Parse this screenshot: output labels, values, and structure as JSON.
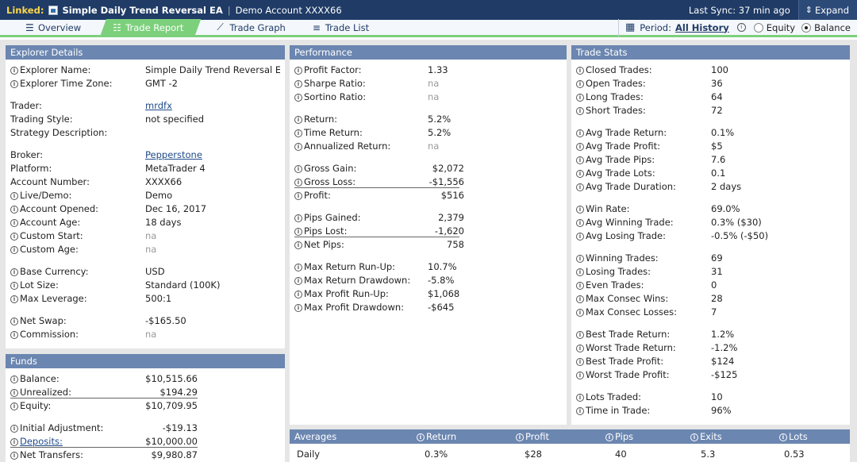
{
  "topbar": {
    "linked_label": "Linked:",
    "ea_name": "Simple Daily Trend Reversal EA",
    "account": "Demo Account XXXX66",
    "last_sync": "Last Sync: 37 min ago",
    "expand_label": "Expand"
  },
  "nav": {
    "tabs": [
      {
        "label": "Overview",
        "icon": "list-icon"
      },
      {
        "label": "Trade Report",
        "icon": "report-icon",
        "active": true
      },
      {
        "label": "Trade Graph",
        "icon": "chart-icon"
      },
      {
        "label": "Trade List",
        "icon": "lines-icon"
      }
    ],
    "period_label": "Period:",
    "period_value": "All History",
    "equity_label": "Equity",
    "balance_label": "Balance",
    "selected_mode": "Balance"
  },
  "explorer": {
    "title": "Explorer Details",
    "rows": [
      {
        "k": "Explorer Name:",
        "v": "Simple Daily Trend Reversal EA",
        "info": true
      },
      {
        "k": "Explorer Time Zone:",
        "v": "GMT -2",
        "info": true
      },
      {
        "k": "Trader:",
        "v": "mrdfx"
      },
      {
        "k": "Trading Style:",
        "v": "not specified"
      },
      {
        "k": "Strategy Description:",
        "v": ""
      },
      {
        "k": "Broker:",
        "v": "Pepperstone"
      },
      {
        "k": "Platform:",
        "v": "MetaTrader 4"
      },
      {
        "k": "Account Number:",
        "v": "XXXX66"
      },
      {
        "k": "Live/Demo:",
        "v": "Demo",
        "info": true
      },
      {
        "k": "Account Opened:",
        "v": "Dec 16, 2017",
        "info": true
      },
      {
        "k": "Account Age:",
        "v": "18 days",
        "info": true
      },
      {
        "k": "Custom Start:",
        "v": "na",
        "info": true
      },
      {
        "k": "Custom Age:",
        "v": "na",
        "info": true
      },
      {
        "k": "Base Currency:",
        "v": "USD",
        "info": true
      },
      {
        "k": "Lot Size:",
        "v": "Standard (100K)",
        "info": true
      },
      {
        "k": "Max Leverage:",
        "v": "500:1",
        "info": true
      },
      {
        "k": "Net Swap:",
        "v": "-$165.50",
        "info": true
      },
      {
        "k": "Commission:",
        "v": "na",
        "info": true
      }
    ]
  },
  "funds": {
    "title": "Funds",
    "rows": [
      {
        "k": "Balance:",
        "v": "$10,515.66"
      },
      {
        "k": "Unrealized:",
        "v": "$194.29"
      },
      {
        "k": "Equity:",
        "v": "$10,709.95"
      },
      {
        "k": "Initial Adjustment:",
        "v": "-$19.13"
      },
      {
        "k": "Deposits:",
        "v": "$10,000.00"
      },
      {
        "k": "Net Transfers:",
        "v": "$9,980.87"
      }
    ]
  },
  "performance": {
    "title": "Performance",
    "rows": [
      {
        "k": "Profit Factor:",
        "v": "1.33"
      },
      {
        "k": "Sharpe Ratio:",
        "v": "na"
      },
      {
        "k": "Sortino Ratio:",
        "v": "na"
      },
      {
        "k": "Return:",
        "v": "5.2%"
      },
      {
        "k": "Time Return:",
        "v": "5.2%"
      },
      {
        "k": "Annualized Return:",
        "v": "na"
      },
      {
        "k": "Gross Gain:",
        "v": "$2,072"
      },
      {
        "k": "Gross Loss:",
        "v": "-$1,556"
      },
      {
        "k": "Profit:",
        "v": "$516"
      },
      {
        "k": "Pips Gained:",
        "v": "2,379"
      },
      {
        "k": "Pips Lost:",
        "v": "-1,620"
      },
      {
        "k": "Net Pips:",
        "v": "758"
      },
      {
        "k": "Max Return Run-Up:",
        "v": "10.7%"
      },
      {
        "k": "Max Return Drawdown:",
        "v": "-5.8%"
      },
      {
        "k": "Max Profit Run-Up:",
        "v": "$1,068"
      },
      {
        "k": "Max Profit Drawdown:",
        "v": "-$645"
      }
    ]
  },
  "stats": {
    "title": "Trade Stats",
    "rows": [
      {
        "k": "Closed Trades:",
        "v": "100"
      },
      {
        "k": "Open Trades:",
        "v": "36"
      },
      {
        "k": "Long Trades:",
        "v": "64"
      },
      {
        "k": "Short Trades:",
        "v": "72"
      },
      {
        "k": "Avg Trade Return:",
        "v": "0.1%"
      },
      {
        "k": "Avg Trade Profit:",
        "v": "$5"
      },
      {
        "k": "Avg Trade Pips:",
        "v": "7.6"
      },
      {
        "k": "Avg Trade Lots:",
        "v": "0.1"
      },
      {
        "k": "Avg Trade Duration:",
        "v": "2 days"
      },
      {
        "k": "Win Rate:",
        "v": "69.0%"
      },
      {
        "k": "Avg Winning Trade:",
        "v": "0.3% ($30)"
      },
      {
        "k": "Avg Losing Trade:",
        "v": "-0.5% (-$50)"
      },
      {
        "k": "Winning Trades:",
        "v": "69"
      },
      {
        "k": "Losing Trades:",
        "v": "31"
      },
      {
        "k": "Even Trades:",
        "v": "0"
      },
      {
        "k": "Max Consec Wins:",
        "v": "28"
      },
      {
        "k": "Max Consec Losses:",
        "v": "7"
      },
      {
        "k": "Best Trade Return:",
        "v": "1.2%"
      },
      {
        "k": "Worst Trade Return:",
        "v": "-1.2%"
      },
      {
        "k": "Best Trade Profit:",
        "v": "$124"
      },
      {
        "k": "Worst Trade Profit:",
        "v": "-$125"
      },
      {
        "k": "Lots Traded:",
        "v": "10"
      },
      {
        "k": "Time in Trade:",
        "v": "96%"
      }
    ]
  },
  "averages": {
    "title": "Averages",
    "headers": [
      "Return",
      "Profit",
      "Pips",
      "Exits",
      "Lots"
    ],
    "rows": [
      {
        "label": "Daily",
        "values": [
          "0.3%",
          "$28",
          "40",
          "5.3",
          "0.53"
        ]
      }
    ]
  }
}
